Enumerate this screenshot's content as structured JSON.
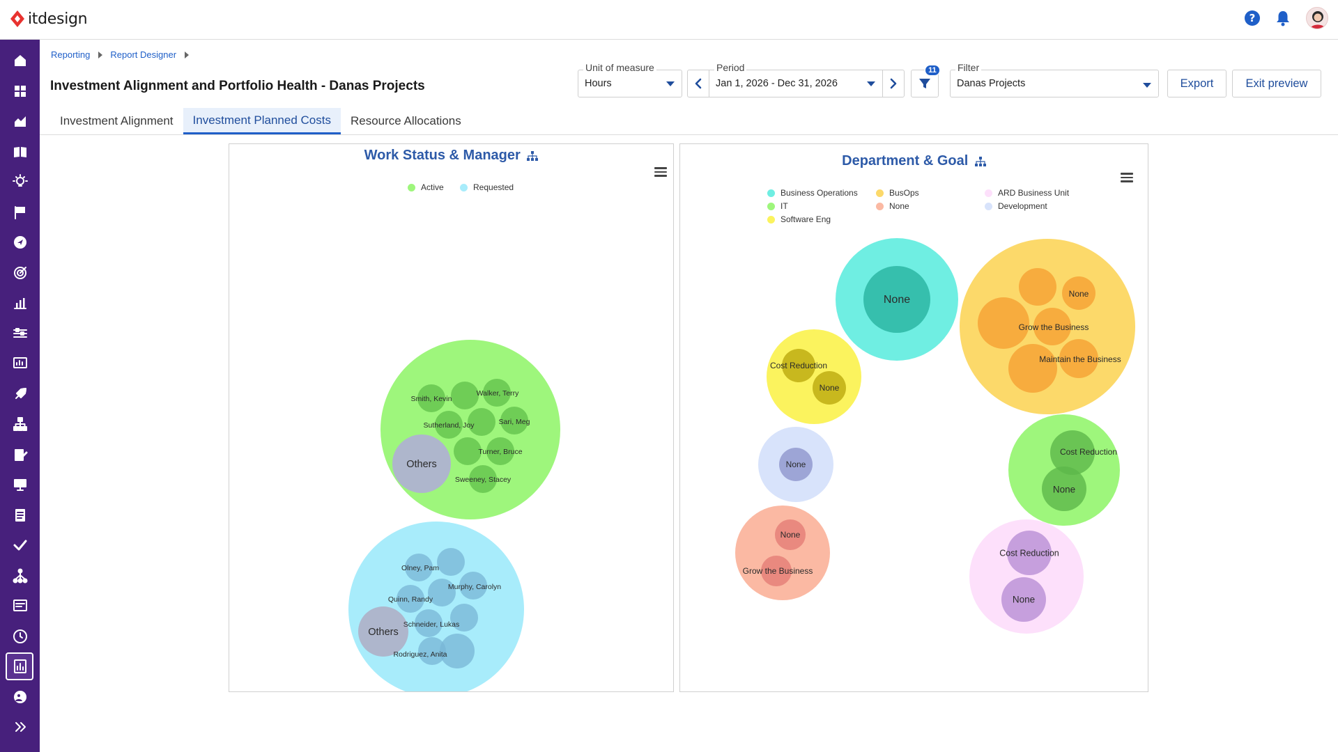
{
  "app": {
    "brand": "itdesign"
  },
  "breadcrumb": [
    "Reporting",
    "Report Designer"
  ],
  "page": {
    "title": "Investment Alignment and Portfolio Health - Danas Projects"
  },
  "controls": {
    "unit_label": "Unit of measure",
    "unit_value": "Hours",
    "period_label": "Period",
    "period_value": "Jan 1, 2026 - Dec 31, 2026",
    "filter_count": "11",
    "filter_label": "Filter",
    "filter_value": "Danas Projects",
    "export_label": "Export",
    "exit_label": "Exit preview"
  },
  "tabs": [
    {
      "label": "Investment Alignment",
      "active": false
    },
    {
      "label": "Investment Planned Costs",
      "active": true
    },
    {
      "label": "Resource Allocations",
      "active": false
    }
  ],
  "chart_data": [
    {
      "type": "packed-bubble",
      "title": "Work Status & Manager",
      "legend": [
        {
          "name": "Active",
          "color": "#9ef67c"
        },
        {
          "name": "Requested",
          "color": "#a8ecfb"
        }
      ],
      "groups": [
        {
          "name": "Active",
          "color": "#9ef67c",
          "nodeColor": "#5fbf49",
          "nodes": [
            "Smith, Kevin",
            "Walker, Terry",
            "Sutherland, Joy",
            "Sari, Meg",
            "Turner, Bruce",
            "Sweeney, Stacey",
            "Others"
          ]
        },
        {
          "name": "Requested",
          "color": "#a8ecfb",
          "nodeColor": "#78b6d6",
          "nodes": [
            "Olney, Pam",
            "Murphy, Carolyn",
            "Quinn, Randy",
            "Schneider, Lukas",
            "Rodriguez, Anita",
            "Others"
          ]
        }
      ]
    },
    {
      "type": "packed-bubble",
      "title": "Department & Goal",
      "legend": [
        {
          "name": "Business Operations",
          "color": "#6feee2"
        },
        {
          "name": "BusOps",
          "color": "#fcd96a"
        },
        {
          "name": "ARD Business Unit",
          "color": "#fde0fb"
        },
        {
          "name": "IT",
          "color": "#9ef67c"
        },
        {
          "name": "None",
          "color": "#fbb9a3"
        },
        {
          "name": "Development",
          "color": "#d8e3fb"
        },
        {
          "name": "Software Eng",
          "color": "#fbf35e"
        }
      ],
      "groups": [
        {
          "name": "Business Operations",
          "nodes": [
            "None"
          ]
        },
        {
          "name": "BusOps",
          "nodes": [
            "None",
            "Grow the Business",
            "Maintain the Business"
          ]
        },
        {
          "name": "Software Eng",
          "nodes": [
            "Cost Reduction",
            "None"
          ]
        },
        {
          "name": "Development",
          "nodes": [
            "None"
          ]
        },
        {
          "name": "IT",
          "nodes": [
            "Cost Reduction",
            "None"
          ]
        },
        {
          "name": "None",
          "nodes": [
            "None",
            "Grow the Business"
          ]
        },
        {
          "name": "ARD Business Unit",
          "nodes": [
            "Cost Reduction",
            "None"
          ]
        }
      ]
    }
  ]
}
